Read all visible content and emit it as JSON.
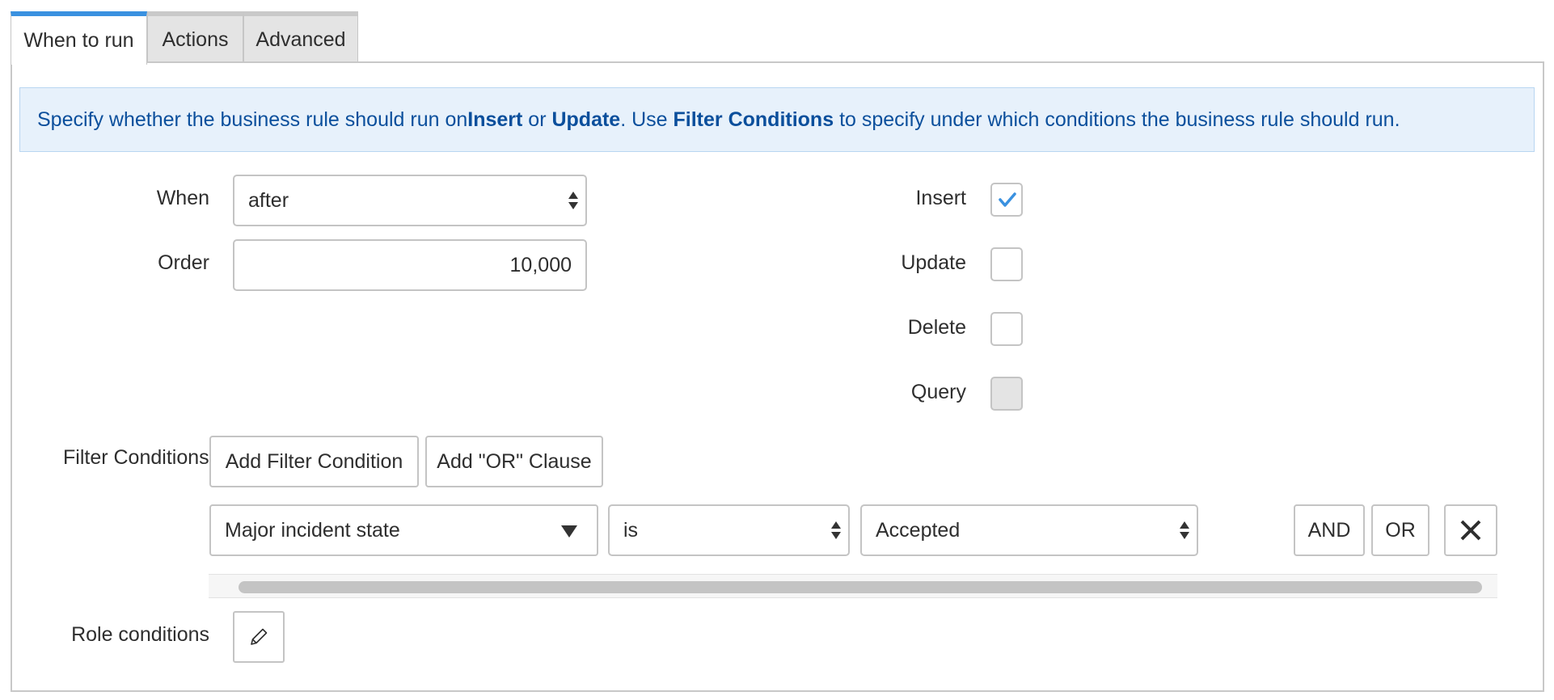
{
  "tabs": [
    {
      "label": "When to run",
      "active": true
    },
    {
      "label": "Actions",
      "active": false
    },
    {
      "label": "Advanced",
      "active": false
    }
  ],
  "info": {
    "part1": "Specify whether the business rule should run on ",
    "insert": "Insert",
    "part2": " or ",
    "update": "Update",
    "part3": ". Use ",
    "filter_conditions": "Filter Conditions",
    "part4": " to specify under which conditions the business rule should run."
  },
  "when": {
    "label": "When",
    "value": "after"
  },
  "order": {
    "label": "Order",
    "value": "10,000"
  },
  "checkboxes": {
    "insert": {
      "label": "Insert",
      "checked": true
    },
    "update": {
      "label": "Update",
      "checked": false
    },
    "delete": {
      "label": "Delete",
      "checked": false
    },
    "query": {
      "label": "Query",
      "checked": false,
      "disabled": true
    }
  },
  "filter": {
    "label": "Filter Conditions",
    "add_condition_label": "Add Filter Condition",
    "add_or_label": "Add \"OR\" Clause",
    "field": "Major incident state",
    "operator": "is",
    "value": "Accepted",
    "and_label": "AND",
    "or_label": "OR"
  },
  "role": {
    "label": "Role conditions"
  },
  "icons": {
    "checkmark": "check-icon",
    "dropdown": "caret-down-icon",
    "spinner": "up-down-arrows-icon",
    "remove": "close-icon",
    "edit": "pencil-icon"
  },
  "colors": {
    "accent": "#3a91e0",
    "banner_bg": "#e7f1fb",
    "banner_text": "#0b4f9c"
  }
}
